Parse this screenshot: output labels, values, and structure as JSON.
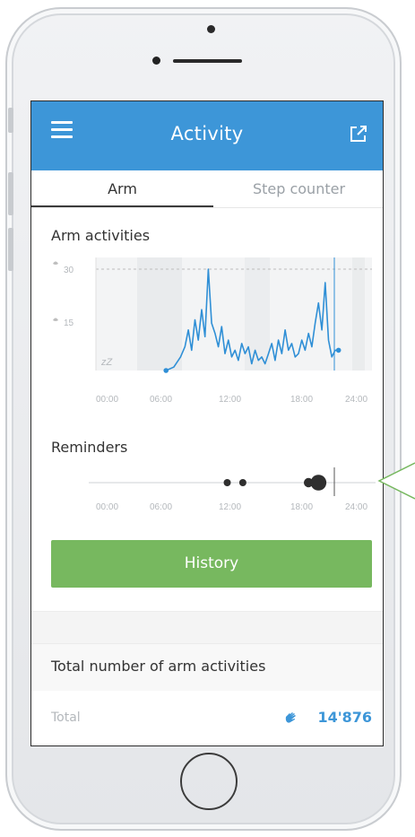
{
  "header": {
    "title": "Activity",
    "menu_icon": "hamburger-menu-icon",
    "share_icon": "external-share-icon"
  },
  "tabs": [
    {
      "label": "Arm",
      "active": true
    },
    {
      "label": "Step counter",
      "active": false
    }
  ],
  "arm_activities": {
    "title": "Arm activities",
    "y_ticks": [
      "30",
      "15"
    ],
    "sleep_label": "zZ",
    "x_ticks": [
      "00:00",
      "06:00",
      "12:00",
      "18:00",
      "24:00"
    ]
  },
  "reminders": {
    "title": "Reminders",
    "x_ticks": [
      "00:00",
      "06:00",
      "12:00",
      "18:00",
      "24:00"
    ]
  },
  "history_button": "History",
  "total_section": {
    "title": "Total number of arm activities",
    "label": "Total",
    "value": "14'876"
  },
  "colors": {
    "accent": "#3d96d8",
    "history": "#77b85f",
    "chart_line": "#2f8fd6"
  },
  "chart_data": [
    {
      "type": "line",
      "title": "Arm activities",
      "xlabel": "",
      "ylabel": "",
      "x_range": [
        "00:00",
        "24:00"
      ],
      "ylim": [
        0,
        30
      ],
      "y_ticks": [
        15,
        30
      ],
      "grid": "dashed line at 30",
      "series": [
        {
          "x": [
            6.3,
            7.0,
            7.6,
            8.0,
            8.3,
            8.6,
            8.9,
            9.2,
            9.5,
            9.8,
            10.1,
            10.4,
            10.7,
            11.0,
            11.3,
            11.6,
            11.9,
            12.2,
            12.5,
            12.8,
            13.1,
            13.4,
            13.7,
            14.0,
            14.3,
            14.6,
            14.9,
            15.2,
            15.5,
            15.8,
            16.1,
            16.4,
            16.7,
            17.0,
            17.3,
            17.6,
            17.9,
            18.2,
            18.5,
            18.8,
            19.1,
            19.4,
            19.7,
            20.0,
            20.3,
            20.6,
            20.9,
            21.2,
            21.5,
            21.8
          ],
          "y": [
            0,
            1,
            4,
            7,
            12,
            6,
            15,
            9,
            18,
            10,
            30,
            14,
            11,
            7,
            13,
            5,
            9,
            4,
            6,
            3,
            8,
            5,
            7,
            2,
            6,
            3,
            4,
            2,
            5,
            8,
            3,
            9,
            5,
            12,
            6,
            8,
            4,
            5,
            9,
            6,
            11,
            7,
            14,
            20,
            12,
            26,
            9,
            4,
            6,
            6
          ]
        }
      ]
    },
    {
      "type": "scatter",
      "title": "Reminders",
      "x_range": [
        "00:00",
        "24:00"
      ],
      "series": [
        {
          "x": [
            11.8,
            13.2,
            19.1,
            20.0
          ],
          "size": [
            1,
            1,
            1.3,
            2.2
          ]
        }
      ]
    }
  ]
}
